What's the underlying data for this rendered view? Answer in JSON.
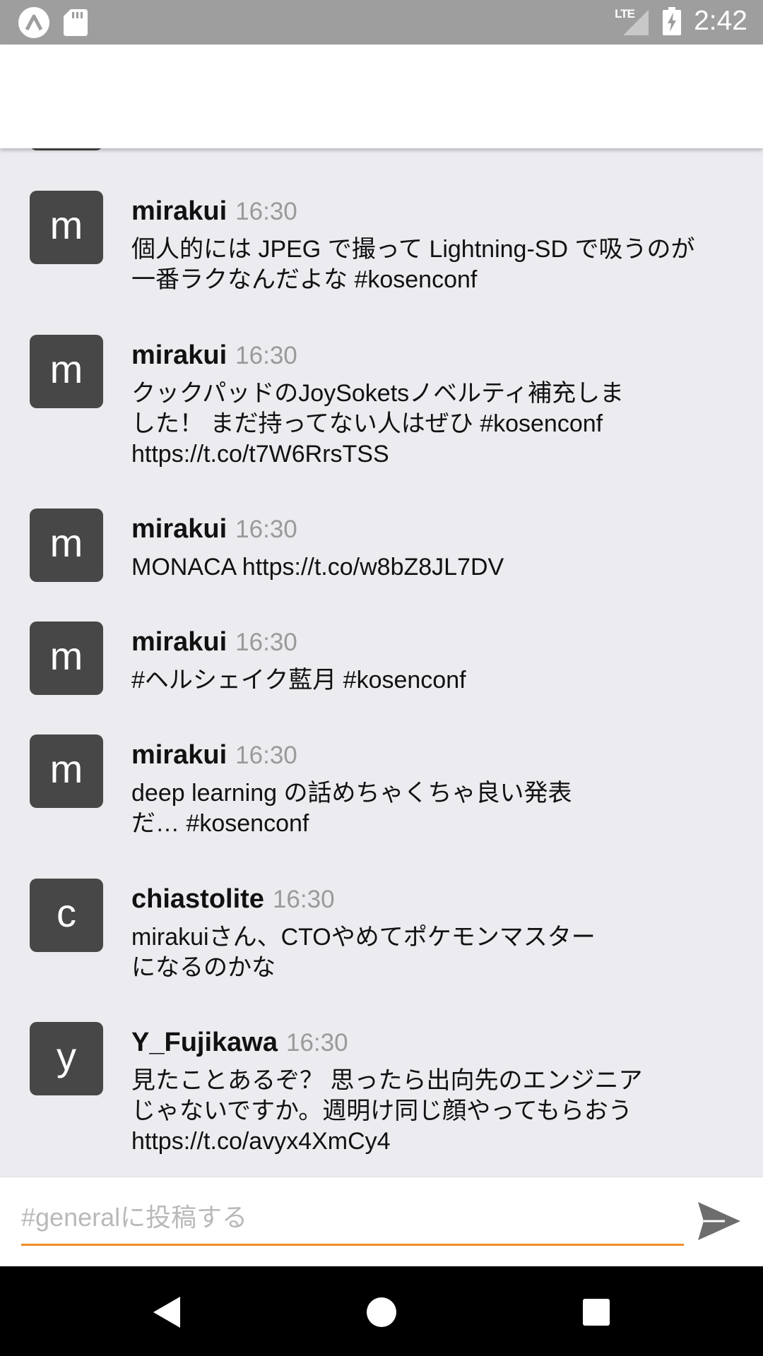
{
  "status_bar": {
    "time": "2:42",
    "network": "LTE"
  },
  "messages": [
    {
      "initial": "m",
      "user": "mirakui",
      "time": "16:30",
      "text": "個人的には JPEG で撮って Lightning-SD で吸うのが\n一番ラクなんだよな #kosenconf"
    },
    {
      "initial": "m",
      "user": "mirakui",
      "time": "16:30",
      "text": "クックパッドのJoySoketsノベルティ補充しま\nした！ まだ持ってない人はぜひ #kosenconf\nhttps://t.co/t7W6RrsTSS"
    },
    {
      "initial": "m",
      "user": "mirakui",
      "time": "16:30",
      "text": "MONACA https://t.co/w8bZ8JL7DV"
    },
    {
      "initial": "m",
      "user": "mirakui",
      "time": "16:30",
      "text": "#ヘルシェイク藍月 #kosenconf"
    },
    {
      "initial": "m",
      "user": "mirakui",
      "time": "16:30",
      "text": "deep learning の話めちゃくちゃ良い発表\nだ… #kosenconf"
    },
    {
      "initial": "c",
      "user": "chiastolite",
      "time": "16:30",
      "text": "mirakuiさん、CTOやめてポケモンマスター\nになるのかな"
    },
    {
      "initial": "y",
      "user": "Y_Fujikawa",
      "time": "16:30",
      "text": "見たことあるぞ？ 思ったら出向先のエンジニア\nじゃないですか。週明け同じ顔やってもらおう\nhttps://t.co/avyx4XmCy4"
    }
  ],
  "composer": {
    "placeholder": "#generalに投稿する",
    "value": ""
  },
  "colors": {
    "accent": "#f08c2a",
    "avatar": "#474747",
    "background": "#ebebf0",
    "status_bar": "#9e9e9e"
  },
  "icons": {
    "status_left": [
      "app-logo-icon",
      "sd-card-icon"
    ],
    "status_right": [
      "lte-signal-icon",
      "battery-charging-icon"
    ],
    "composer": "send-icon",
    "nav": [
      "back-icon",
      "home-icon",
      "recents-icon"
    ]
  }
}
